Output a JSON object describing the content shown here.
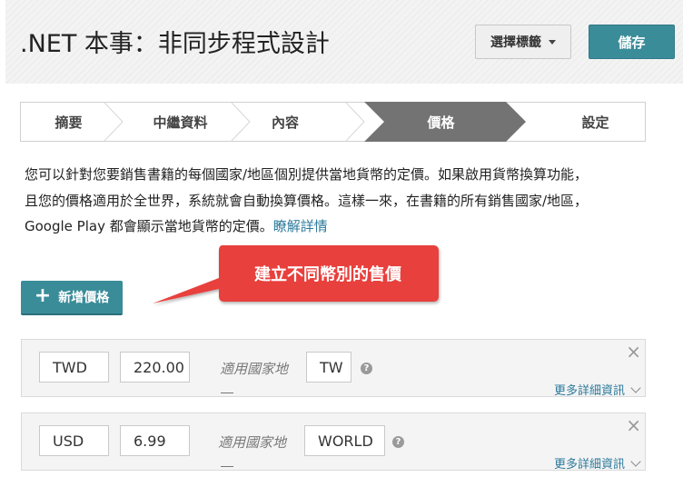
{
  "header": {
    "title": ".NET 本事：非同步程式設計",
    "select_tag_label": "選擇標籤",
    "save_label": "儲存"
  },
  "steps": [
    {
      "label": "摘要",
      "active": false
    },
    {
      "label": "中繼資料",
      "active": false
    },
    {
      "label": "內容",
      "active": false
    },
    {
      "label": "價格",
      "active": true
    },
    {
      "label": "設定",
      "active": false
    }
  ],
  "description": {
    "line1": "您可以針對您要銷售書籍的每個國家/地區個別提供當地貨幣的定價。如果啟用貨幣換算功能，",
    "line2": "且您的價格適用於全世界，系統就會自動換算價格。這樣一來，在書籍的所有銷售國家/地區，",
    "line3": "Google Play 都會顯示當地貨幣的定價。",
    "learn_more": "瞭解詳情"
  },
  "add_price": {
    "icon": "plus-icon",
    "label": "新增價格"
  },
  "callout": {
    "text": "建立不同幣別的售價",
    "color": "#e8413c"
  },
  "prices": [
    {
      "currency": "TWD",
      "amount": "220.00",
      "applies_label": "適用國家地",
      "region": "TW",
      "more_label": "更多詳細資訊"
    },
    {
      "currency": "USD",
      "amount": "6.99",
      "applies_label": "適用國家地",
      "region": "WORLD",
      "more_label": "更多詳細資訊"
    }
  ],
  "colors": {
    "accent": "#3a8c99",
    "active_step": "#737373",
    "link": "#2b7a9b"
  }
}
